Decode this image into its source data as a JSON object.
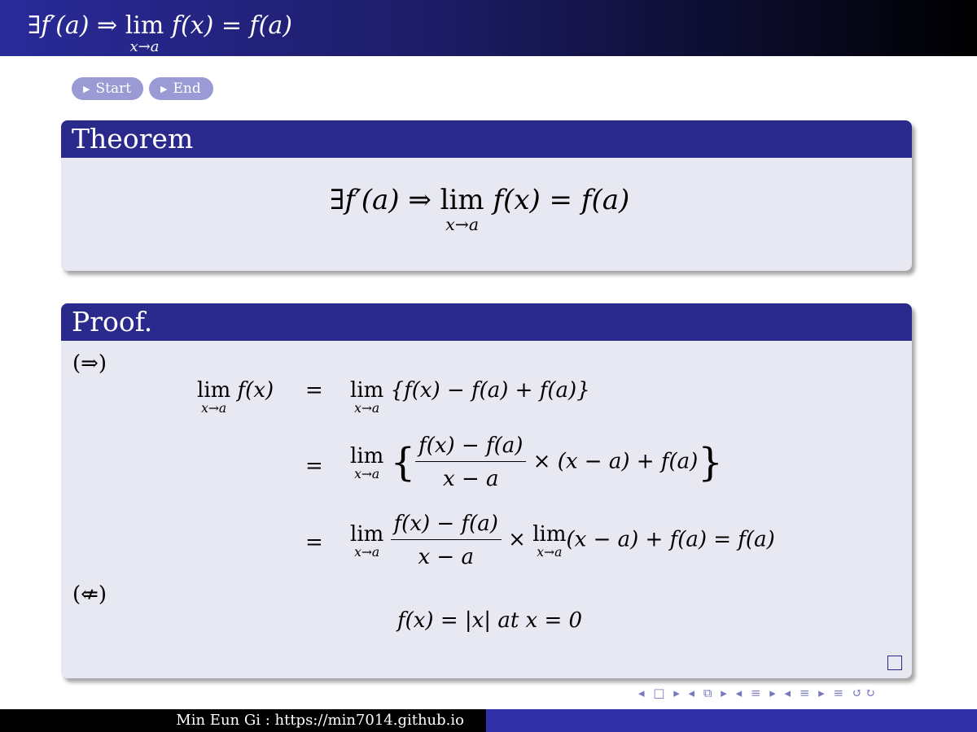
{
  "frame_title": "∃f′(a) ⇒ lim f(x) = f(a)",
  "buttons": {
    "start": "Start",
    "end": "End"
  },
  "theorem": {
    "title": "Theorem",
    "lim_sub": "x→a"
  },
  "proof": {
    "title": "Proof.",
    "forward_symbol": "(⇒)",
    "backward_symbol": "(⇍)",
    "counterexample": "f(x) = |x| at x = 0",
    "lim_sub": "x→a"
  },
  "nav_symbols": "◂ □ ▸ ◂ ⧉ ▸ ◂ ≡ ▸ ◂ ≡ ▸   ≡   ↺↻",
  "footer": {
    "author": "Min Eun Gi : https://min7014.github.io"
  },
  "colors": {
    "block_header": "#2a2a8c",
    "block_body": "#e8e8f2",
    "button": "#9a9ad4"
  }
}
